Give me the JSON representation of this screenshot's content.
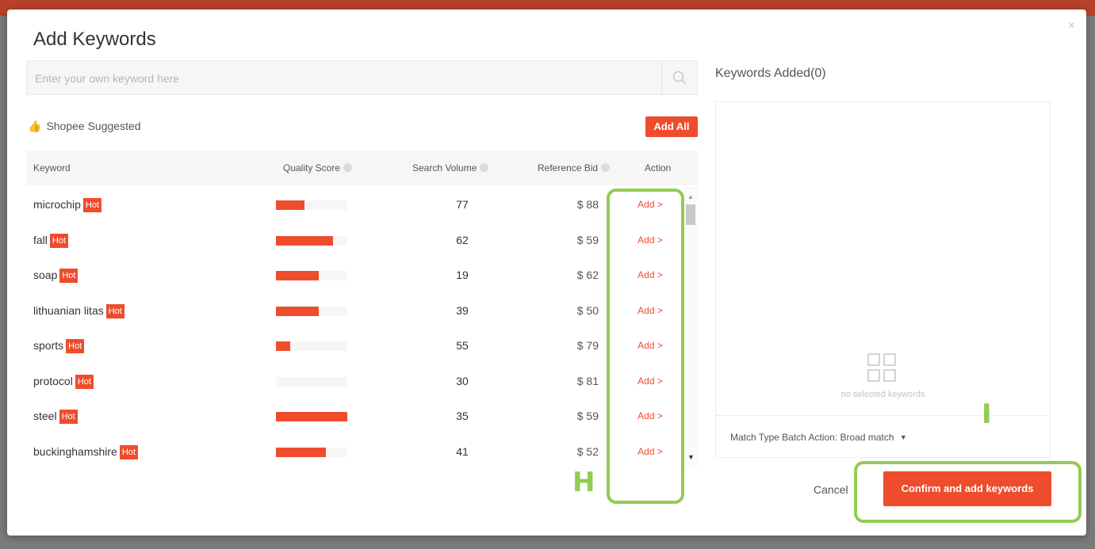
{
  "modal": {
    "title": "Add Keywords",
    "close_label": "×"
  },
  "search": {
    "placeholder": "Enter your own keyword here"
  },
  "suggested": {
    "label": "Shopee Suggested",
    "add_all_label": "Add All"
  },
  "table": {
    "headers": {
      "keyword": "Keyword",
      "quality_score": "Quality Score",
      "search_volume": "Search Volume",
      "reference_bid": "Reference Bid",
      "action": "Action"
    },
    "hot_label": "Hot",
    "action_label": "Add >",
    "rows": [
      {
        "keyword": "microchip",
        "quality_score": 0.4,
        "search_volume": "77",
        "reference_bid": "$ 88"
      },
      {
        "keyword": "fall",
        "quality_score": 0.8,
        "search_volume": "62",
        "reference_bid": "$ 59"
      },
      {
        "keyword": "soap",
        "quality_score": 0.6,
        "search_volume": "19",
        "reference_bid": "$ 62"
      },
      {
        "keyword": "lithuanian litas",
        "quality_score": 0.6,
        "search_volume": "39",
        "reference_bid": "$ 50"
      },
      {
        "keyword": "sports",
        "quality_score": 0.2,
        "search_volume": "55",
        "reference_bid": "$ 79"
      },
      {
        "keyword": "protocol",
        "quality_score": 0.0,
        "search_volume": "30",
        "reference_bid": "$ 81"
      },
      {
        "keyword": "steel",
        "quality_score": 1.0,
        "search_volume": "35",
        "reference_bid": "$ 59"
      },
      {
        "keyword": "buckinghamshire",
        "quality_score": 0.7,
        "search_volume": "41",
        "reference_bid": "$ 52"
      }
    ]
  },
  "right_panel": {
    "title": "Keywords Added(0)",
    "empty_text": "no selected keywords",
    "match_type_label": "Match Type Batch Action: Broad match"
  },
  "footer": {
    "cancel_label": "Cancel",
    "confirm_label": "Confirm and add keywords"
  },
  "annotations": {
    "h_label": "H",
    "i_label": "I",
    "color": "#92cc52"
  },
  "colors": {
    "accent": "#ee4d2d"
  }
}
